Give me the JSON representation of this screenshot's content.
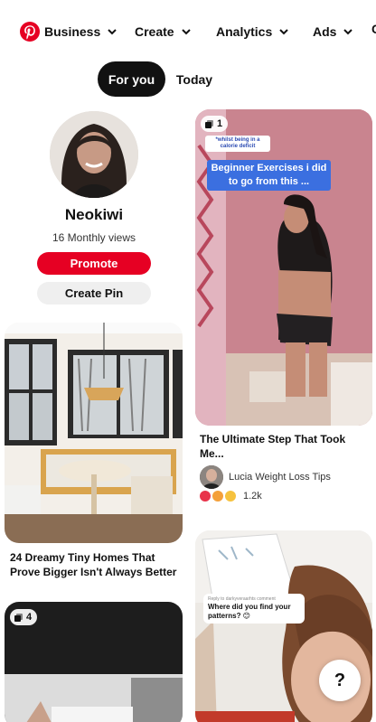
{
  "nav": {
    "items": [
      {
        "label": "Business"
      },
      {
        "label": "Create"
      },
      {
        "label": "Analytics"
      },
      {
        "label": "Ads"
      }
    ],
    "cut_off_label": "C"
  },
  "tabs": [
    {
      "label": "For you",
      "active": true
    },
    {
      "label": "Today",
      "active": false
    }
  ],
  "profile": {
    "name": "Neokiwi",
    "views": "16 Monthly views",
    "promote_label": "Promote",
    "create_pin_label": "Create Pin"
  },
  "pins": {
    "step_pin": {
      "badge": "1",
      "caption_small": "*whilst being in a calorie deficit",
      "caption_main": "Beginner Exercises i did to go from this ...",
      "title": "The Ultimate Step That Took Me...",
      "author": "Lucia Weight Loss Tips",
      "reaction_count": "1.2k"
    },
    "tiny_homes_pin": {
      "title": "24 Dreamy Tiny Homes That Prove Bigger Isn't Always Better"
    },
    "carousel_pin": {
      "badge": "4"
    },
    "patterns_pin": {
      "reply_to": "Reply to darkyveraarhts comment",
      "caption": "Where did you find your patterns? 😊"
    }
  },
  "help": {
    "label": "?"
  },
  "colors": {
    "brand": "#e60023",
    "active_tab": "#111111"
  }
}
